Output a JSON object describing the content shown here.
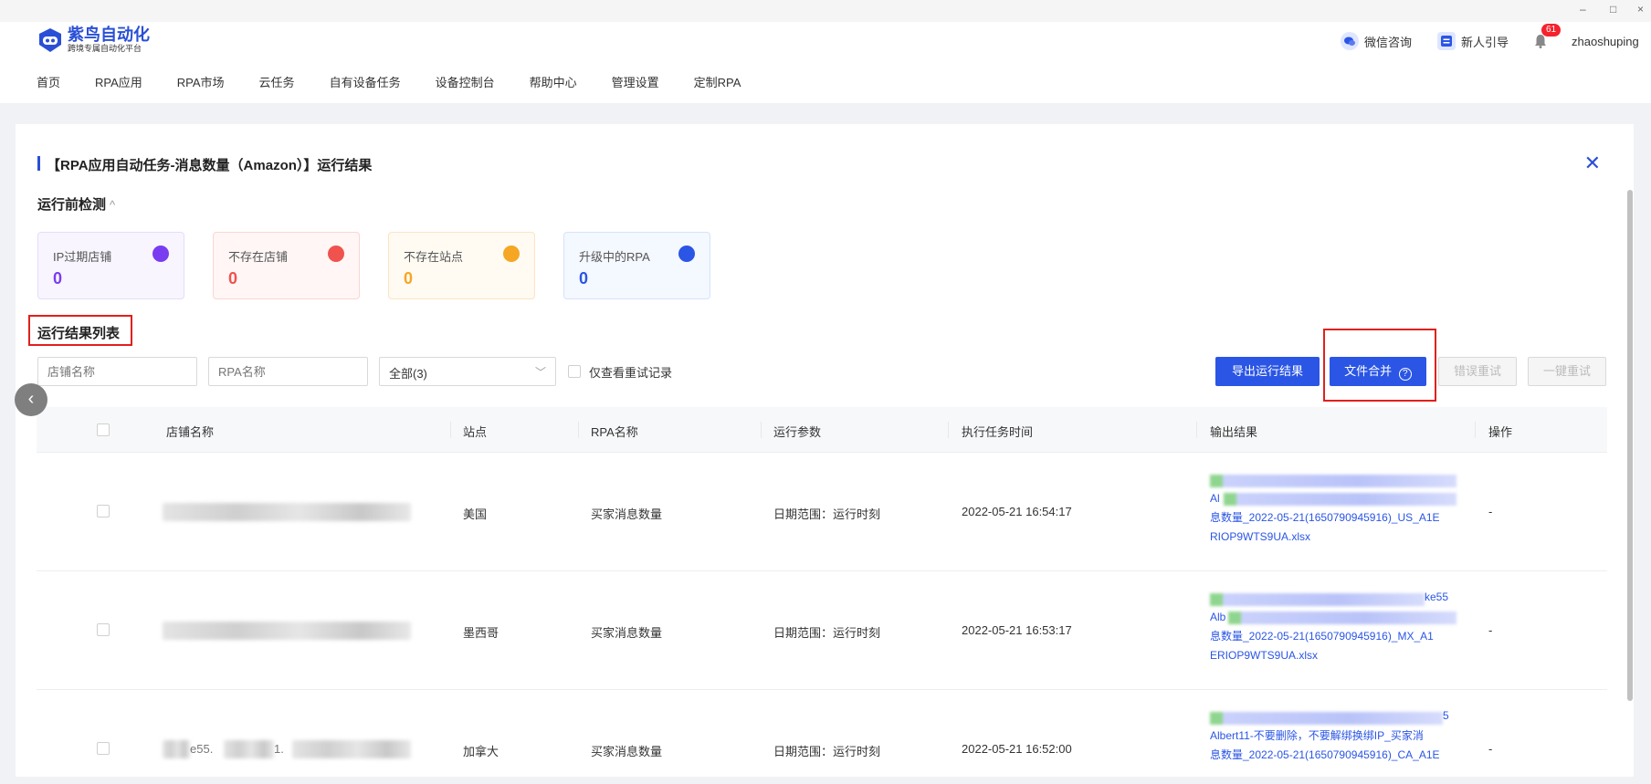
{
  "window": {
    "minimize": "–",
    "maximize": "□",
    "close": "×"
  },
  "header": {
    "logo_title": "紫鸟自动化",
    "logo_sub": "跨境专属自动化平台",
    "wechat": "微信咨询",
    "guide": "新人引导",
    "notify_count": "61",
    "username": "zhaoshuping"
  },
  "nav": [
    "首页",
    "RPA应用",
    "RPA市场",
    "云任务",
    "自有设备任务",
    "设备控制台",
    "帮助中心",
    "管理设置",
    "定制RPA"
  ],
  "page": {
    "title": "【RPA应用自动任务-消息数量（Amazon）】运行结果",
    "precheck_title": "运行前检测",
    "precheck_chevron": "^",
    "list_title": "运行结果列表"
  },
  "stats": [
    {
      "label": "IP过期店铺",
      "value": "0",
      "color": "#7a3cf0"
    },
    {
      "label": "不存在店铺",
      "value": "0",
      "color": "#f0524d"
    },
    {
      "label": "不存在站点",
      "value": "0",
      "color": "#f5a623"
    },
    {
      "label": "升级中的RPA",
      "value": "0",
      "color": "#2a55e5"
    }
  ],
  "filters": {
    "shop_placeholder": "店铺名称",
    "rpa_placeholder": "RPA名称",
    "select_value": "全部(3)",
    "retry_only_label": "仅查看重试记录"
  },
  "buttons": {
    "export": "导出运行结果",
    "merge": "文件合并",
    "merge_help": "?",
    "error_retry": "错误重试",
    "one_click_retry": "一键重试"
  },
  "table": {
    "headers": [
      "店铺名称",
      "站点",
      "RPA名称",
      "运行参数",
      "执行任务时间",
      "输出结果",
      "操作"
    ],
    "rows": [
      {
        "site": "美国",
        "rpa": "买家消息数量",
        "params": "日期范围：运行时刻",
        "time": "2022-05-21 16:54:17",
        "output_lines": [
          "Al",
          "息数量_2022-05-21(1650790945916)_US_A1E",
          "RIOP9WTS9UA.xlsx"
        ],
        "op": "-"
      },
      {
        "site": "墨西哥",
        "rpa": "买家消息数量",
        "params": "日期范围：运行时刻",
        "time": "2022-05-21 16:53:17",
        "output_lines": [
          "Alb",
          "息数量_2022-05-21(1650790945916)_MX_A1",
          "ERIOP9WTS9UA.xlsx"
        ],
        "output_tail": "ke55",
        "op": "-"
      },
      {
        "site": "加拿大",
        "rpa": "买家消息数量",
        "params": "日期范围：运行时刻",
        "time": "2022-05-21 16:52:00",
        "output_lines": [
          "Albert11-不要删除，不要解绑换绑IP_买家消",
          "息数量_2022-05-21(1650790945916)_CA_A1E"
        ],
        "output_tail": "5",
        "shop_partial": "e55.",
        "shop_partial2": "1.",
        "op": "-"
      }
    ]
  }
}
